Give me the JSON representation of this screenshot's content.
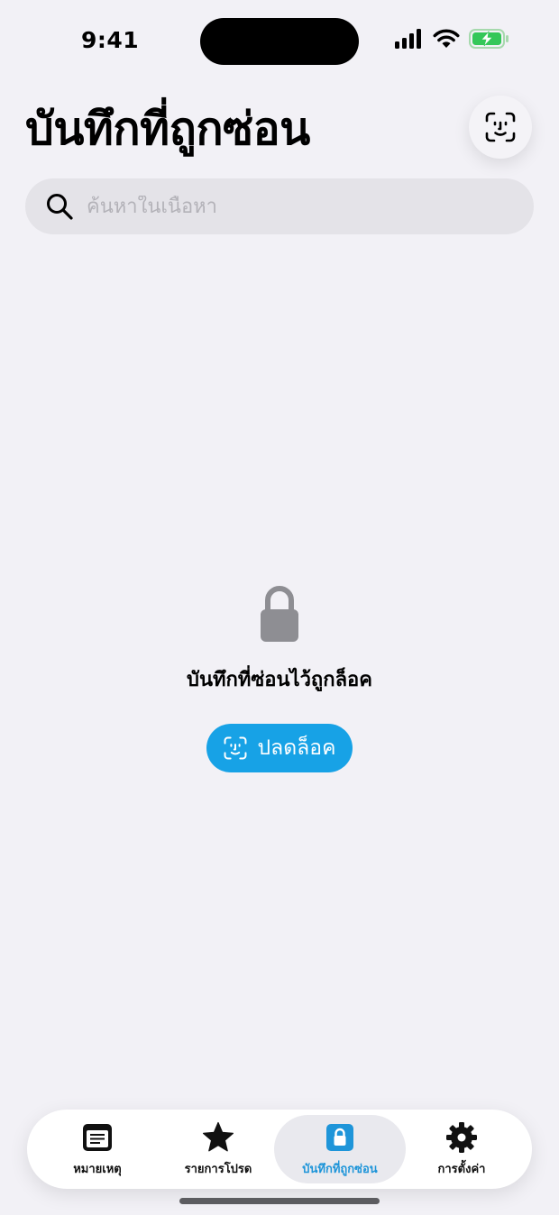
{
  "status_bar": {
    "time": "9:41"
  },
  "header": {
    "title": "บันทึกที่ถูกซ่อน",
    "faceid_icon": "faceid-icon"
  },
  "search": {
    "placeholder": "ค้นหาในเนื้อหา",
    "value": ""
  },
  "locked_state": {
    "message": "บันทึกที่ซ่อนไว้ถูกล็อค",
    "unlock_label": "ปลดล็อค"
  },
  "tabs": [
    {
      "label": "หมายเหตุ",
      "icon": "notes-icon",
      "active": false
    },
    {
      "label": "รายการโปรด",
      "icon": "star-icon",
      "active": false
    },
    {
      "label": "บันทึกที่ถูกซ่อน",
      "icon": "lock-icon",
      "active": true
    },
    {
      "label": "การตั้งค่า",
      "icon": "gear-icon",
      "active": false
    }
  ],
  "colors": {
    "accent": "#17a2e6",
    "active_tab_text": "#1e95d9",
    "battery_green": "#34c759",
    "background": "#f2f1f6"
  }
}
